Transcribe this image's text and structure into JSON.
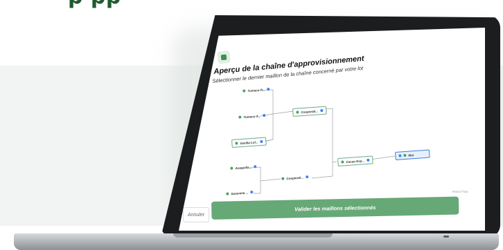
{
  "hero": {
    "heading": "p   pp"
  },
  "modal": {
    "close_label": "×",
    "title": "Aperçu de la chaîne d'approvisionnement",
    "subtitle": "Sélectionner le dernier maillon de la chaîne concerné par votre lot",
    "watermark": "React Flow",
    "cancel_label": "Annuler",
    "validate_label": "Valider les maillons sélectionnés"
  },
  "chain": {
    "nodes": [
      {
        "label": "Tumaco P..."
      },
      {
        "label": "Tumaco A..."
      },
      {
        "label": "Cooperati..."
      },
      {
        "label": "Vanilla Lol..."
      },
      {
        "label": "Cacao Exp..."
      },
      {
        "label": "Moi"
      },
      {
        "label": "Anaquilla..."
      },
      {
        "label": "Cooperati..."
      },
      {
        "label": "Saravena ..."
      }
    ]
  },
  "colors": {
    "accent_green": "#67a877",
    "heading_green": "#1f5a2f",
    "node_border": "#6ea886",
    "target_blue": "#3d7fd6"
  }
}
